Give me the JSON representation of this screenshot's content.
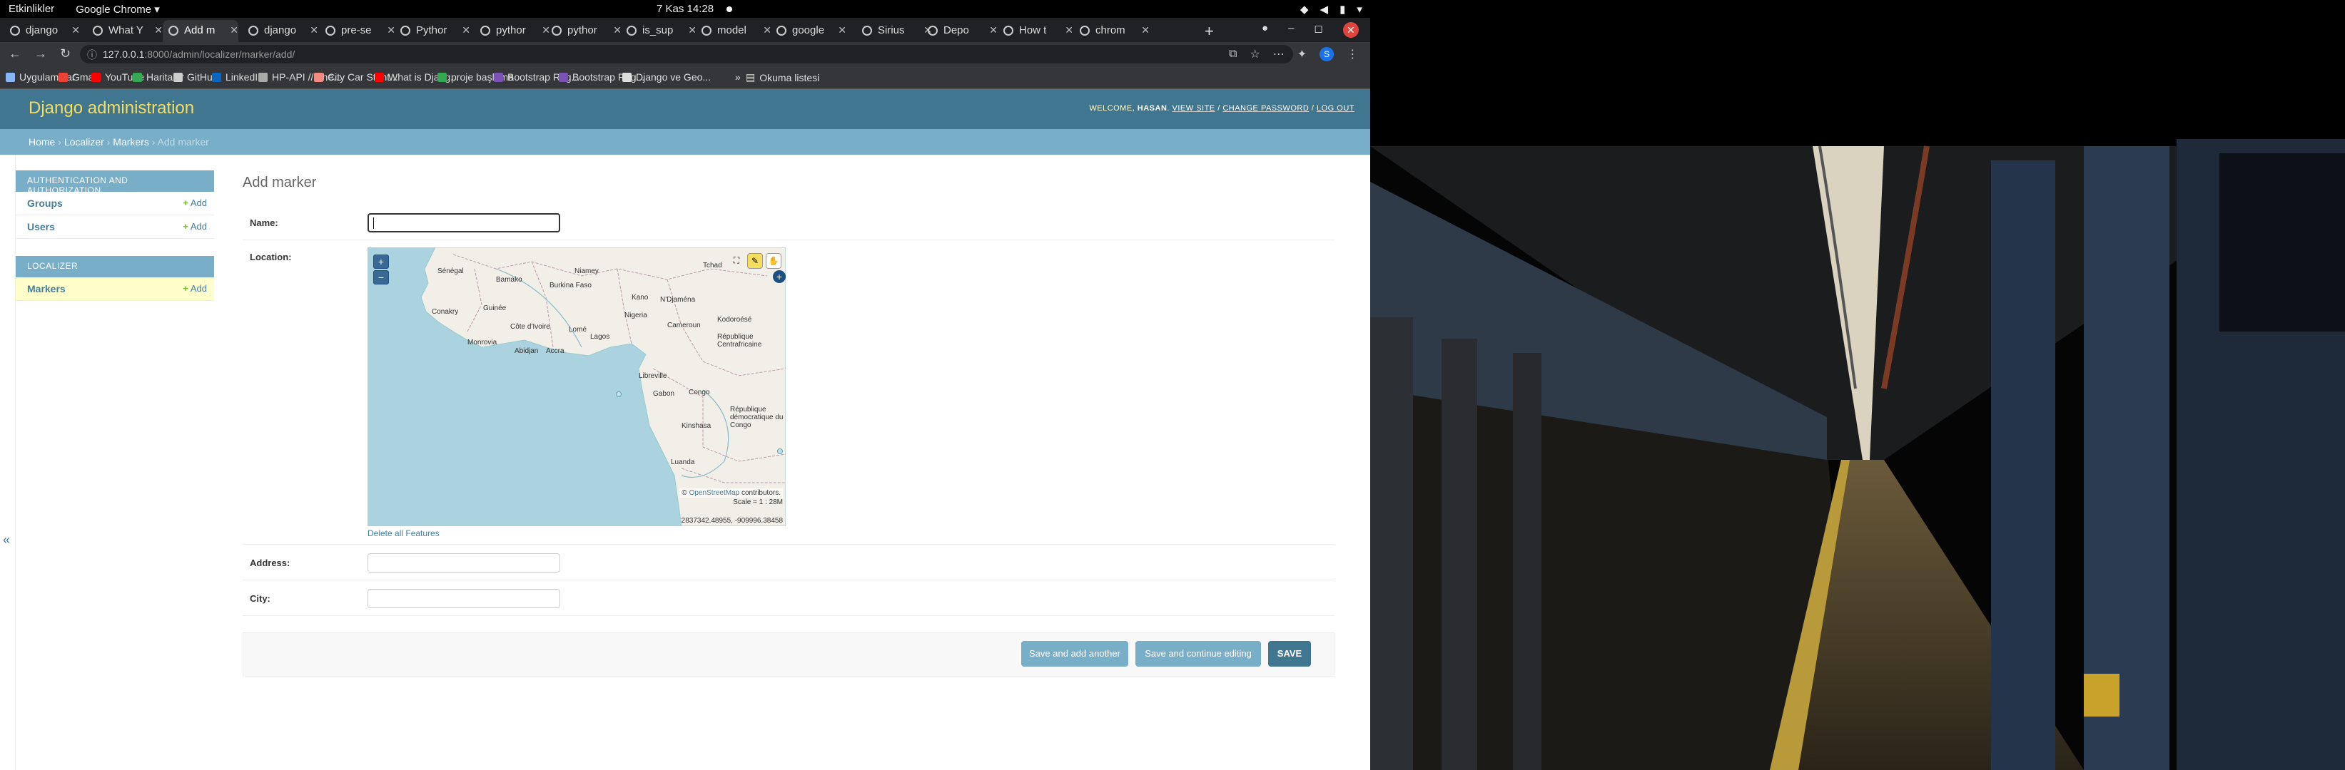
{
  "topbar": {
    "activities": "Etkinlikler",
    "app_menu": "Google Chrome ▾",
    "clock": "7 Kas  14:28"
  },
  "tabs": [
    {
      "title": "django"
    },
    {
      "title": "What Y"
    },
    {
      "title": "Add m"
    },
    {
      "title": "django"
    },
    {
      "title": "pre-se"
    },
    {
      "title": "Pythor"
    },
    {
      "title": "pythor"
    },
    {
      "title": "pythor"
    },
    {
      "title": "is_sup"
    },
    {
      "title": "model"
    },
    {
      "title": "google"
    },
    {
      "title": "Sirius"
    },
    {
      "title": "Depo"
    },
    {
      "title": "How t"
    },
    {
      "title": "chrom"
    }
  ],
  "address_bar": {
    "host": "127.0.0.1",
    "path": ":8000/admin/localizer/marker/add/"
  },
  "bookmarks": [
    {
      "label": "Uygulamalar",
      "color": "#8ab4f8"
    },
    {
      "label": "Gmail",
      "color": "#ea4335"
    },
    {
      "label": "YouTube",
      "color": "#ff0000"
    },
    {
      "label": "Haritalar",
      "color": "#34a853"
    },
    {
      "label": "GitHub",
      "color": "#cccccc"
    },
    {
      "label": "LinkedIn",
      "color": "#0a66c2"
    },
    {
      "label": "HP-API // The...",
      "color": "#aaaaaa"
    },
    {
      "label": "City Car Stunt...",
      "color": "#f28b82"
    },
    {
      "label": "What is Djang...",
      "color": "#ff0000"
    },
    {
      "label": "proje başlama",
      "color": "#34a853"
    },
    {
      "label": "Bootstrap Reg...",
      "color": "#7952b3"
    },
    {
      "label": "Bootstrap Reg...",
      "color": "#7952b3"
    },
    {
      "label": "Django ve Geo...",
      "color": "#dddddd"
    }
  ],
  "reading_list": "Okuma listesi",
  "admin": {
    "branding": "Django administration",
    "welcome": "WELCOME,",
    "username": "HASAN",
    "view_site": "VIEW SITE",
    "change_password": "CHANGE PASSWORD",
    "log_out": "LOG OUT",
    "separator": " / ",
    "breadcrumbs": {
      "home": "Home",
      "app": "Localizer",
      "model": "Markers",
      "current": "Add marker",
      "sep": " › "
    }
  },
  "sidebar": {
    "modules": [
      {
        "caption": "Authentication and Authorization",
        "models": [
          {
            "name": "Groups",
            "add": "Add"
          },
          {
            "name": "Users",
            "add": "Add"
          }
        ]
      },
      {
        "caption": "Localizer",
        "models": [
          {
            "name": "Markers",
            "add": "Add"
          }
        ]
      }
    ]
  },
  "form": {
    "title": "Add marker",
    "fields": {
      "name": {
        "label": "Name:",
        "value": ""
      },
      "location": {
        "label": "Location:"
      },
      "address": {
        "label": "Address:",
        "value": ""
      },
      "city": {
        "label": "City:",
        "value": ""
      }
    },
    "delete_features": "Delete all Features",
    "buttons": {
      "save_add_another": "Save and add another",
      "save_continue": "Save and continue editing",
      "save": "SAVE"
    }
  },
  "map": {
    "attribution_symbol": "©",
    "attribution_link": "OpenStreetMap",
    "attribution_suffix": "contributors.",
    "scale": "Scale = 1 : 28M",
    "mouse_position": "2837342.48955, -909996.38458",
    "labels": [
      "Sénégal",
      "Bamako",
      "Niamey",
      "Burkina Faso",
      "Tchad",
      "Guinée",
      "Conakry",
      "Kano",
      "N'Djaména",
      "Nigeria",
      "Côte d'Ivoire",
      "Lomé",
      "Lagos",
      "Monrovia",
      "Abidjan",
      "Accra",
      "Cameroun",
      "Kodoroésé",
      "République Centrafricaine",
      "Libreville",
      "Gabon",
      "Congo",
      "République démocratique du Congo",
      "Kinshasa",
      "Luanda"
    ]
  },
  "colors": {
    "admin_header": "#417690",
    "admin_branding": "#f5dd5d",
    "admin_accent": "#79aec8",
    "map_sea": "#aad3df",
    "map_land": "#f2efe9"
  }
}
